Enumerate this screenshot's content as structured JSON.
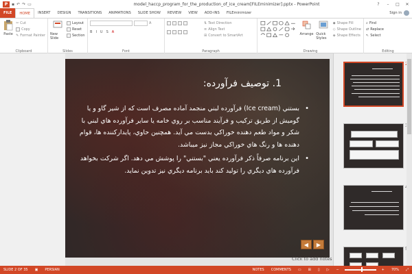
{
  "window": {
    "title": "model_haccp_program_for_the_production_of_ice_cream[FILEminimizer].pptx - PowerPoint",
    "controls": [
      "?",
      "–",
      "□",
      "✕"
    ]
  },
  "qat": {
    "logo": "P"
  },
  "tabs": [
    "FILE",
    "HOME",
    "INSERT",
    "DESIGN",
    "TRANSITIONS",
    "ANIMATIONS",
    "SLIDE SHOW",
    "REVIEW",
    "VIEW",
    "ADD-INS",
    "FILEminimizer"
  ],
  "active_tab": "HOME",
  "signin": "Sign in",
  "ribbon": {
    "clipboard": {
      "paste": "Paste",
      "cut": "Cut",
      "copy": "Copy",
      "format_painter": "Format Painter",
      "label": "Clipboard"
    },
    "slides": {
      "new_slide": "New Slide",
      "layout": "Layout",
      "reset": "Reset",
      "section": "Section",
      "label": "Slides"
    },
    "font": {
      "label": "Font"
    },
    "paragraph": {
      "text_direction": "Text Direction",
      "align_text": "Align Text",
      "convert_smartart": "Convert to SmartArt",
      "label": "Paragraph"
    },
    "drawing": {
      "arrange": "Arrange",
      "quick_styles": "Quick Styles",
      "shape_fill": "Shape Fill",
      "shape_outline": "Shape Outline",
      "shape_effects": "Shape Effects",
      "label": "Drawing"
    },
    "editing": {
      "find": "Find",
      "replace": "Replace",
      "select": "Select",
      "label": "Editing"
    }
  },
  "slide": {
    "title": "1. توصيف فرآورده:",
    "bullets": [
      "بستني (Ice cream) فرآورده لبني منجمد آماده مصرف است كه از شير گاو و يا گوميش از طريق تركيب و فرآيند مناسب بر روي خامه يا ساير فرآورده هاي لبني با شكر و مواد طعم دهنده خوراكي بدست مي آيد. همچنين حاوي، پايداركننده ها، قوام دهنده ها و رنگ هاي خوراكي مجاز نيز ميباشد.",
      "اين برنامه صرفاً ذكر فرآورده يعني \"بستني\" را پوشش مي دهد. اگر شركت بخواهد فرآورده هاي ديگري را توليد كند بايد برنامه ديگري نيز تدوين نمايد."
    ],
    "nav_prev": "◀",
    "nav_next": "▶"
  },
  "notes_placeholder": "Click to add notes",
  "thumbnails": [
    {
      "num": "2",
      "selected": true
    },
    {
      "num": "3",
      "selected": false
    },
    {
      "num": "4",
      "selected": false
    },
    {
      "num": "5",
      "selected": false
    }
  ],
  "statusbar": {
    "slide_info": "SLIDE 2 OF 35",
    "language": "PERSIAN",
    "notes": "NOTES",
    "comments": "COMMENTS",
    "zoom": "70%"
  },
  "colors": {
    "accent": "#d24726",
    "slide_bg": "#2e2928"
  }
}
